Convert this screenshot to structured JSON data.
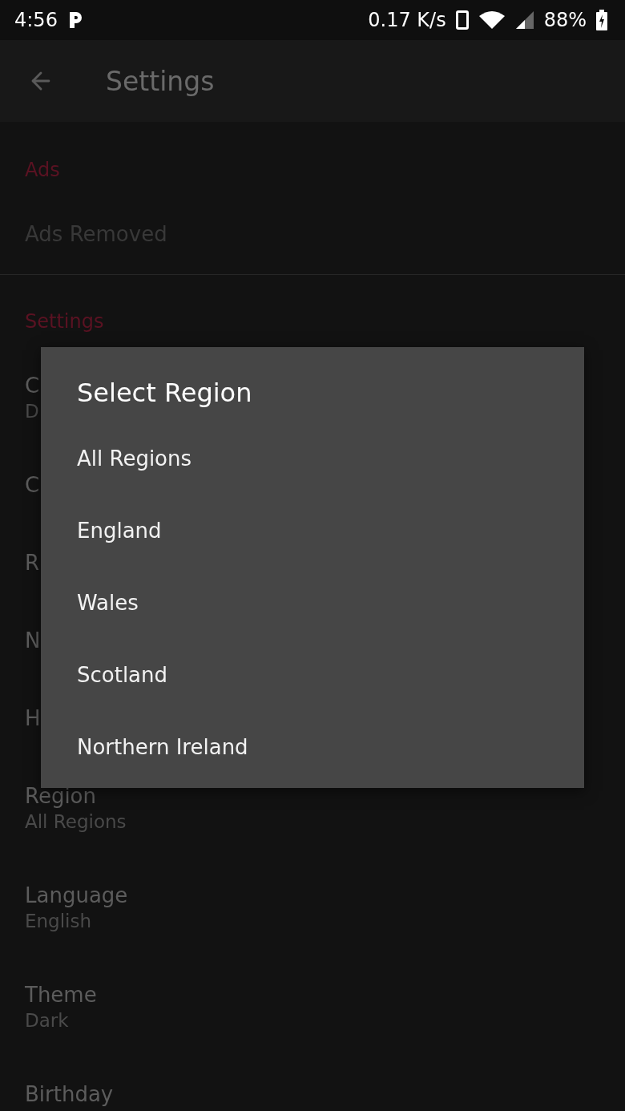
{
  "status_bar": {
    "time": "4:56",
    "network_speed": "0.17 K/s",
    "battery": "88%"
  },
  "app_bar": {
    "title": "Settings"
  },
  "sections": [
    {
      "header": "Ads",
      "items": [
        {
          "title": "Ads Removed",
          "disabled": true
        }
      ]
    },
    {
      "header": "Settings",
      "items": [
        {
          "title": "C",
          "subtitle": "D",
          "disabled": false
        },
        {
          "title": "C",
          "disabled": false
        },
        {
          "title": "R",
          "disabled": false
        },
        {
          "title": "N",
          "disabled": false
        },
        {
          "title": "H",
          "disabled": false
        },
        {
          "title": "Region",
          "subtitle": "All Regions",
          "disabled": false
        },
        {
          "title": "Language",
          "subtitle": "English",
          "disabled": false
        },
        {
          "title": "Theme",
          "subtitle": "Dark",
          "disabled": false
        },
        {
          "title": "Birthday",
          "disabled": false
        }
      ]
    }
  ],
  "dialog": {
    "title": "Select Region",
    "options": [
      {
        "label": "All Regions"
      },
      {
        "label": "England"
      },
      {
        "label": "Wales"
      },
      {
        "label": "Scotland"
      },
      {
        "label": "Northern Ireland"
      }
    ]
  }
}
